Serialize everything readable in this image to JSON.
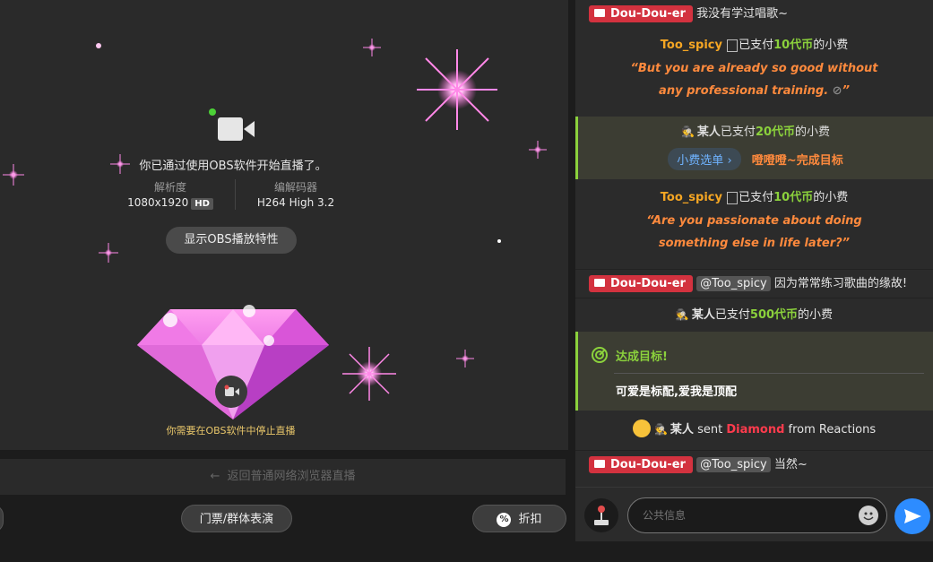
{
  "stage": {
    "obs_message": "你已通过使用OBS软件开始直播了。",
    "resolution_label": "解析度",
    "resolution_value": "1080x1920",
    "hd_badge": "HD",
    "codec_label": "编解码器",
    "codec_value": "H264 High 3.2",
    "show_obs_button": "显示OBS播放特性",
    "stop_note": "你需要在OBS软件中停止直播"
  },
  "back_bar": {
    "label": "返回普通网络浏览器直播"
  },
  "bottom_buttons": {
    "ticket": "门票/群体表演",
    "discount_icon": "%",
    "discount": "折扣"
  },
  "chat": {
    "messages": [
      {
        "user": "Dou-Dou-er",
        "text": "我没有学过唱歌~"
      },
      {
        "user": "Too_spicy",
        "tip_prefix": "已支付",
        "amount": "10代币",
        "suffix": "的小费",
        "quote_line1": "“But you are already so good without",
        "quote_line2": "any professional training. ",
        "quote_end": "”"
      },
      {
        "user": "某人",
        "tip_prefix": "已支付",
        "amount": "20代币",
        "suffix": "的小费",
        "menu": "小费选单",
        "action": "噔噔噔~完成目标"
      },
      {
        "user": "Too_spicy",
        "tip_prefix": "已支付",
        "amount": "10代币",
        "suffix": "的小费",
        "quote_line1": "“Are you passionate about doing",
        "quote_line2": "something else in life later?”"
      },
      {
        "user": "Dou-Dou-er",
        "mention": "@Too_spicy",
        "text": "因为常常练习歌曲的缘故!"
      },
      {
        "user": "某人",
        "tip_prefix": "已支付",
        "amount": "500代币",
        "suffix": "的小费"
      },
      {
        "goal_title": "达成目标!",
        "goal_body": "可爱是标配,爱我是顶配"
      },
      {
        "user": "某人",
        "sent": "sent",
        "gift": "Diamond",
        "from": "from Reactions"
      },
      {
        "user": "Dou-Dou-er",
        "mention": "@Too_spicy",
        "text": "当然~"
      }
    ],
    "input_placeholder": "公共信息"
  },
  "colors": {
    "accent_green": "#8bd13c",
    "name_orange": "#f5a623",
    "quote_orange": "#ff8a3d",
    "model_badge_red": "#d3323f",
    "send_blue": "#2d8cff"
  },
  "icons": [
    "video-camera-icon",
    "arrow-left-icon",
    "percent-icon",
    "note-icon",
    "spy-icon",
    "chevron-right-icon",
    "goal-icon",
    "heart-eyes-emoji-icon",
    "joystick-icon",
    "emoji-icon",
    "send-icon",
    "hidden-eye-icon"
  ]
}
